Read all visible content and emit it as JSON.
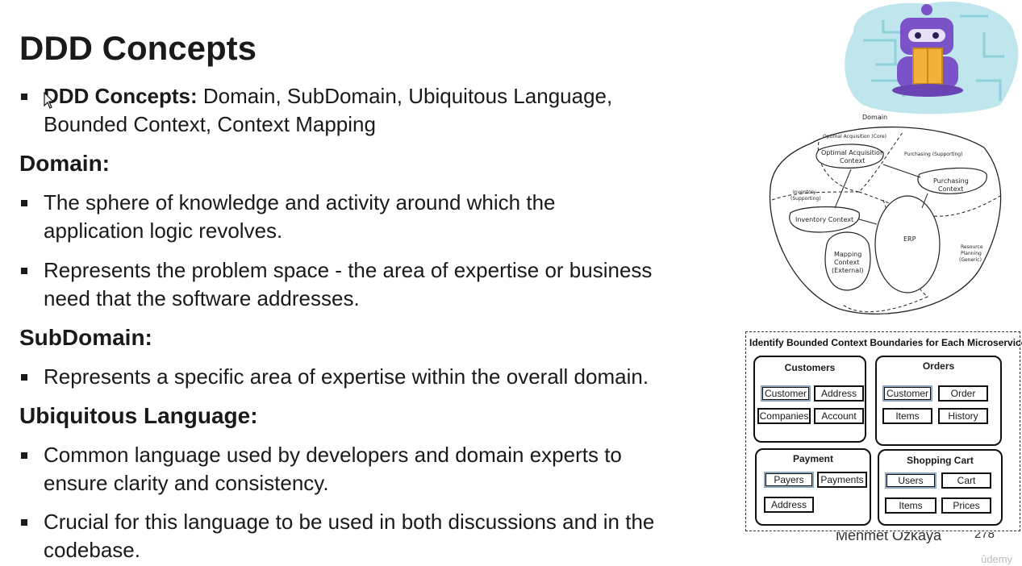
{
  "slide": {
    "title": "DDD Concepts",
    "intro": {
      "lead": "DDD Concepts:",
      "rest": " Domain, SubDomain, Ubiquitous Language,",
      "line2": "Bounded Context, Context Mapping"
    },
    "sections": {
      "domain": {
        "heading": "Domain:",
        "bullets": [
          [
            "The sphere of knowledge and activity around which the",
            "application logic revolves."
          ],
          [
            "Represents the problem space - the area of expertise or business",
            "need that the software addresses."
          ]
        ]
      },
      "subdomain": {
        "heading": "SubDomain:",
        "bullets": [
          [
            "Represents a specific area of expertise within the overall domain."
          ]
        ]
      },
      "ubiquitous": {
        "heading": "Ubiquitous Language:",
        "bullets": [
          [
            "Common language used by developers and domain experts to",
            "ensure clarity and consistency."
          ],
          [
            "Crucial for this language to be used in both discussions and in the",
            "codebase."
          ]
        ]
      }
    }
  },
  "domain_diagram": {
    "title": "Domain",
    "labels": {
      "optimal_core": "Optimal Acquisition (Core)",
      "optimal_context": [
        "Optimal Acquisition",
        "Context"
      ],
      "purchasing_supporting": "Purchasing (Supporting)",
      "purchasing_context": [
        "Purchasing",
        "Context"
      ],
      "inventory_supporting": [
        "Inventory",
        "(Supporting)"
      ],
      "inventory_context": "Inventory Context",
      "erp": "ERP",
      "mapping_context": [
        "Mapping",
        "Context",
        "(External)"
      ],
      "resource_planning": [
        "Resource",
        "Planning",
        "(Generic)"
      ]
    }
  },
  "bounded_contexts": {
    "title": "Identify Bounded Context Boundaries for Each Microservices",
    "groups": {
      "customers": {
        "title": "Customers",
        "chips": [
          "Customer",
          "Address",
          "Companies",
          "Account"
        ]
      },
      "orders": {
        "title": "Orders",
        "chips": [
          "Customer",
          "Order",
          "Items",
          "History"
        ]
      },
      "payment": {
        "title": "Payment",
        "chips": [
          "Payers",
          "Payments",
          "Address"
        ]
      },
      "cart": {
        "title": "Shopping Cart",
        "chips": [
          "Users",
          "Cart",
          "Items",
          "Prices"
        ]
      }
    }
  },
  "footer": {
    "author": "Mehmet Ozkaya",
    "page": "278",
    "watermark": "ûdemy"
  },
  "icons": {
    "mascot": "dotnet-bot-reading-icon",
    "cursor": "mouse-pointer-icon"
  },
  "colors": {
    "mascot_bg": "#bfe6ec",
    "mascot_body": "#7b52c8",
    "book": "#f2b23a",
    "chip_highlight": "#8fa6bf"
  }
}
